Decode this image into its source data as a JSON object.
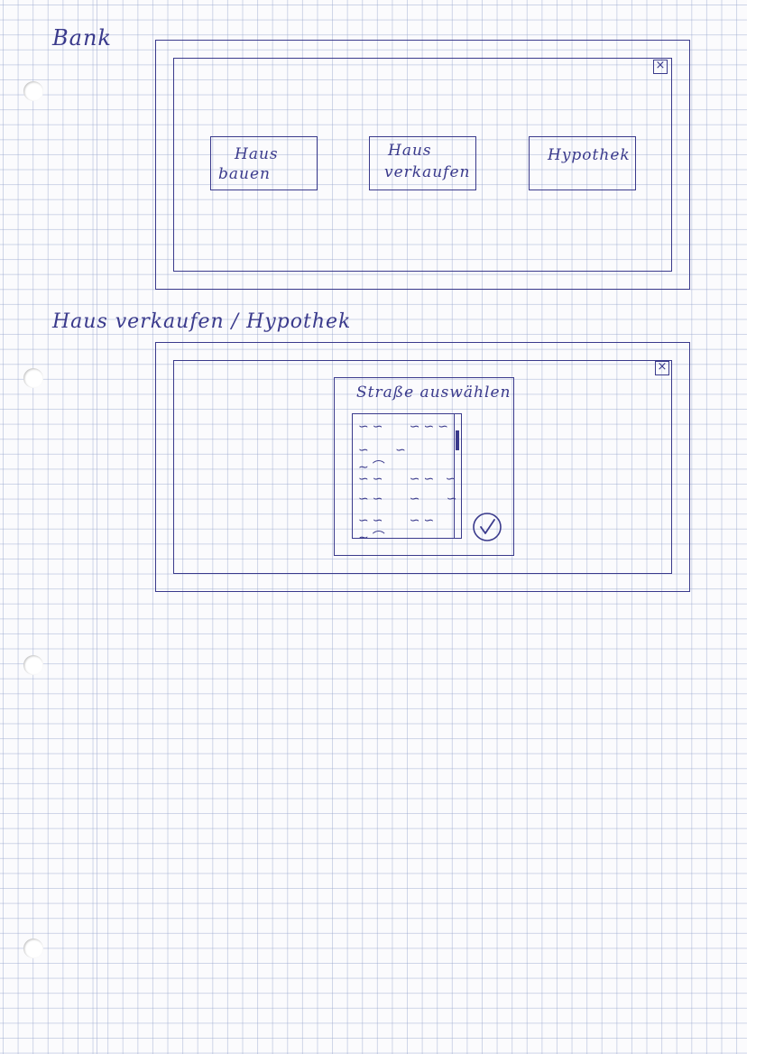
{
  "sketch1": {
    "title": "Bank",
    "close_glyph": "×",
    "buttons": [
      {
        "line1": "Haus",
        "line2": "bauen"
      },
      {
        "line1": "Haus",
        "line2": "verkaufen"
      },
      {
        "line1": "Hypothek",
        "line2": ""
      }
    ]
  },
  "sketch2": {
    "title": "Haus verkaufen / Hypothek",
    "close_glyph": "×",
    "dialog": {
      "title": "Straße auswählen",
      "confirm_icon": "checkmark-circle-icon"
    }
  },
  "colors": {
    "ink": "#3a3a8c",
    "grid": "#96a5cd",
    "paper": "#fbfbfd"
  }
}
